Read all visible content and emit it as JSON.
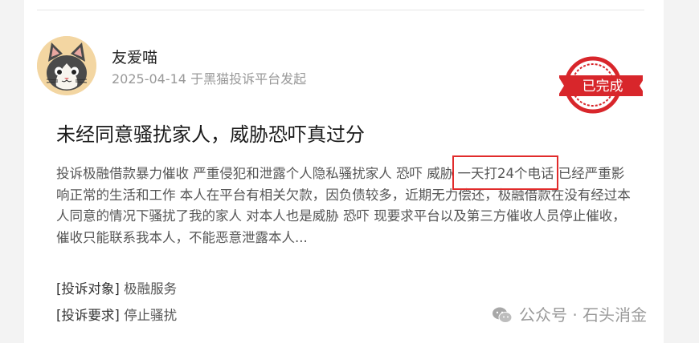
{
  "author": {
    "name": "友爱喵",
    "date": "2025-04-14",
    "source": "于黑猫投诉平台发起"
  },
  "status_stamp": {
    "label": "已完成",
    "color": "#d8262b"
  },
  "post": {
    "title": "未经同意骚扰家人，威胁恐吓真过分",
    "body_before": "投诉极融借款暴力催收 严重侵犯和泄露个人隐私骚扰家人 恐吓 威胁 ",
    "body_highlight": "一天打24个电话",
    "body_after": " 已经严重影响正常的生活和工作 本人在平台有相关欠款，因负债较多，近期无力偿还，极融借款在没有经过本人同意的情况下骚扰了我的家人 对本人也是威胁 恐吓 现要求平台以及第三方催收人员停止催收，催收只能联系我本人，不能恶意泄露本人...",
    "highlight_color": "#e12b2b"
  },
  "fields": [
    {
      "key": "[投诉对象]",
      "value": "极融服务"
    },
    {
      "key": "[投诉要求]",
      "value": "停止骚扰"
    }
  ],
  "watermark": {
    "icon": "wechat-icon",
    "text": "公众号 · 石头消金"
  }
}
